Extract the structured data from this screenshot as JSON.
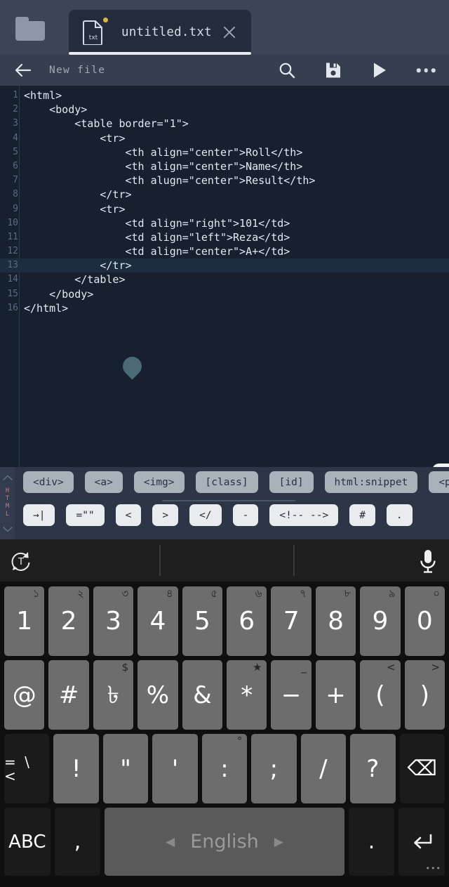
{
  "tabbar": {
    "folder_icon": "folder-icon",
    "tab": {
      "file_icon_label": "txt",
      "title": "untitled.txt",
      "unsaved_dot": "unsaved-indicator",
      "close_icon": "close-icon"
    }
  },
  "actionbar": {
    "back_icon": "back-arrow-icon",
    "title": "New file",
    "search_icon": "search-icon",
    "save_icon": "save-icon",
    "run_icon": "run-icon",
    "more_icon": "more-options-icon"
  },
  "editor": {
    "language_label": "HTML",
    "active_line": 13,
    "lines": [
      {
        "n": "1",
        "text": "<html>"
      },
      {
        "n": "2",
        "text": "    <body>"
      },
      {
        "n": "3",
        "text": "        <table border=\"1\">"
      },
      {
        "n": "4",
        "text": "            <tr>"
      },
      {
        "n": "5",
        "text": "                <th align=\"center\">Roll</th>"
      },
      {
        "n": "6",
        "text": "                <th align=\"center\">Name</th>"
      },
      {
        "n": "7",
        "text": "                <th alugn=\"center\">Result</th>"
      },
      {
        "n": "8",
        "text": "            </tr>"
      },
      {
        "n": "9",
        "text": "            <tr>"
      },
      {
        "n": "10",
        "text": "                <td align=\"right\">101</td>"
      },
      {
        "n": "11",
        "text": "                <td align=\"left\">Reza</td>"
      },
      {
        "n": "12",
        "text": "                <td align=\"center\">A+</td>"
      },
      {
        "n": "13",
        "text": "            </tr>"
      },
      {
        "n": "14",
        "text": "        </table>"
      },
      {
        "n": "15",
        "text": "    </body>"
      },
      {
        "n": "16",
        "text": "</html>"
      }
    ],
    "cursor_handle": "text-cursor-handle",
    "drawer_pull_icon": "chevron-left-icon"
  },
  "snippetbar": {
    "vertical_label": "HTML",
    "scroll_up_icon": "chevron-up-icon",
    "scroll_down_icon": "chevron-down-icon",
    "row1": [
      "<div>",
      "<a>",
      "<img>",
      "[class]",
      "[id]",
      "html:snippet",
      "<p>"
    ],
    "row2": [
      "→|",
      "=\"\"",
      "<",
      ">",
      "</",
      "-",
      "<!-- -->",
      "#",
      "."
    ]
  },
  "keyboard": {
    "suggestion_bar": {
      "transliterate_icon": "transliteration-icon",
      "mic_icon": "microphone-icon"
    },
    "row1": [
      {
        "lbl": "1",
        "sup": "১"
      },
      {
        "lbl": "2",
        "sup": "২"
      },
      {
        "lbl": "3",
        "sup": "৩"
      },
      {
        "lbl": "4",
        "sup": "৪"
      },
      {
        "lbl": "5",
        "sup": "৫"
      },
      {
        "lbl": "6",
        "sup": "৬"
      },
      {
        "lbl": "7",
        "sup": "৭"
      },
      {
        "lbl": "8",
        "sup": "৮"
      },
      {
        "lbl": "9",
        "sup": "৯"
      },
      {
        "lbl": "0",
        "sup": "০"
      }
    ],
    "row2": [
      {
        "lbl": "@",
        "sup": ""
      },
      {
        "lbl": "#",
        "sup": ""
      },
      {
        "lbl": "৳",
        "sup": "$"
      },
      {
        "lbl": "%",
        "sup": ""
      },
      {
        "lbl": "&",
        "sup": ""
      },
      {
        "lbl": "*",
        "sup": "★"
      },
      {
        "lbl": "−",
        "sup": "_"
      },
      {
        "lbl": "+",
        "sup": ""
      },
      {
        "lbl": "(",
        "sup": "<"
      },
      {
        "lbl": ")",
        "sup": ">"
      }
    ],
    "row3": [
      {
        "lbl": "= \\ <",
        "sup": "",
        "kind": "sym"
      },
      {
        "lbl": "!",
        "sup": ""
      },
      {
        "lbl": "\"",
        "sup": ""
      },
      {
        "lbl": "'",
        "sup": ""
      },
      {
        "lbl": ":",
        "sup": "°"
      },
      {
        "lbl": ";",
        "sup": ""
      },
      {
        "lbl": "/",
        "sup": ""
      },
      {
        "lbl": "?",
        "sup": ""
      },
      {
        "lbl": "⌫",
        "sup": "",
        "kind": "backspace"
      }
    ],
    "row4": {
      "abc": "ABC",
      "comma": ",",
      "space_label": "English",
      "space_prev_icon": "prev-language-arrow",
      "space_next_icon": "next-language-arrow",
      "period": ".",
      "enter_icon": "enter-icon",
      "enter_dots": "•••"
    }
  },
  "colors": {
    "editor_bg": "#16202e",
    "toolbar_bg": "#363f4f",
    "tabbar_bg": "#3c4456",
    "accent_unsaved": "#d9b640",
    "lang_label": "#c77e82",
    "keyboard_bg": "#0f0f0f",
    "key_bg": "#6d6d6d"
  }
}
